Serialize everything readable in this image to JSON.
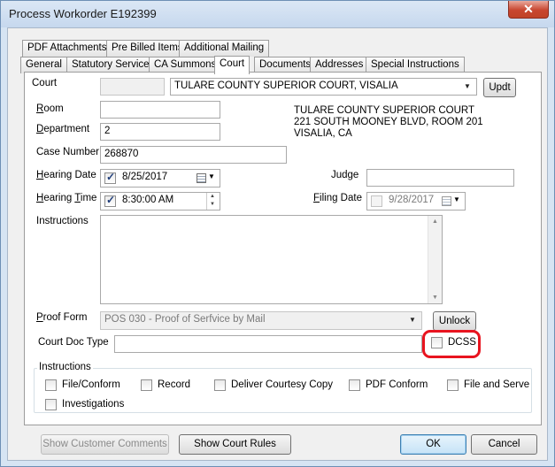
{
  "window": {
    "title": "Process Workorder E192399",
    "close_glyph": "✕"
  },
  "tabs_row1": [
    "PDF Attachments",
    "Pre Billed Items",
    "Additional Mailing"
  ],
  "tabs_row2": [
    "General",
    "Statutory Service",
    "CA Summons",
    "Court",
    "Documents",
    "Addresses",
    "Special Instructions"
  ],
  "court": {
    "label": "Court",
    "code_value": "",
    "selected": "TULARE COUNTY SUPERIOR COURT, VISALIA",
    "updt_label": "Updt",
    "address_lines": [
      "TULARE COUNTY SUPERIOR COURT",
      "221 SOUTH MOONEY BLVD, ROOM 201",
      "VISALIA, CA"
    ]
  },
  "room": {
    "label": "Room",
    "value": ""
  },
  "department": {
    "label": "Department",
    "value": "2"
  },
  "case_number": {
    "label": "Case Number",
    "value": "268870"
  },
  "hearing_date": {
    "label": "Hearing Date",
    "value": "8/25/2017",
    "checked": true
  },
  "hearing_time": {
    "label": "Hearing Time",
    "value": "8:30:00 AM",
    "checked": true
  },
  "judge": {
    "label": "Judge",
    "value": ""
  },
  "filing_date": {
    "label": "Filing Date",
    "value": "9/28/2017",
    "checked": false
  },
  "instructions_field": {
    "label": "Instructions",
    "value": ""
  },
  "proof_form": {
    "label": "Proof Form",
    "value": "POS 030 - Proof of Serfvice by Mail",
    "unlock_label": "Unlock"
  },
  "court_doc_type": {
    "label": "Court Doc Type",
    "value": ""
  },
  "dcss": {
    "label": "DCSS",
    "checked": false
  },
  "instructions_group": {
    "title": "Instructions",
    "options": [
      "File/Conform",
      "Record",
      "Deliver Courtesy Copy",
      "PDF Conform",
      "File and Serve",
      "Investigations"
    ]
  },
  "footer": {
    "show_customer_comments": "Show Customer Comments",
    "show_court_rules": "Show Court Rules",
    "ok": "OK",
    "cancel": "Cancel"
  },
  "colors": {
    "highlight": "#e8141f",
    "accent": "#3c7fb1"
  },
  "icons": [
    "close-icon",
    "dropdown-arrow-icon",
    "calendar-icon",
    "spinner-icon",
    "scrollbar-arrow-icon"
  ]
}
